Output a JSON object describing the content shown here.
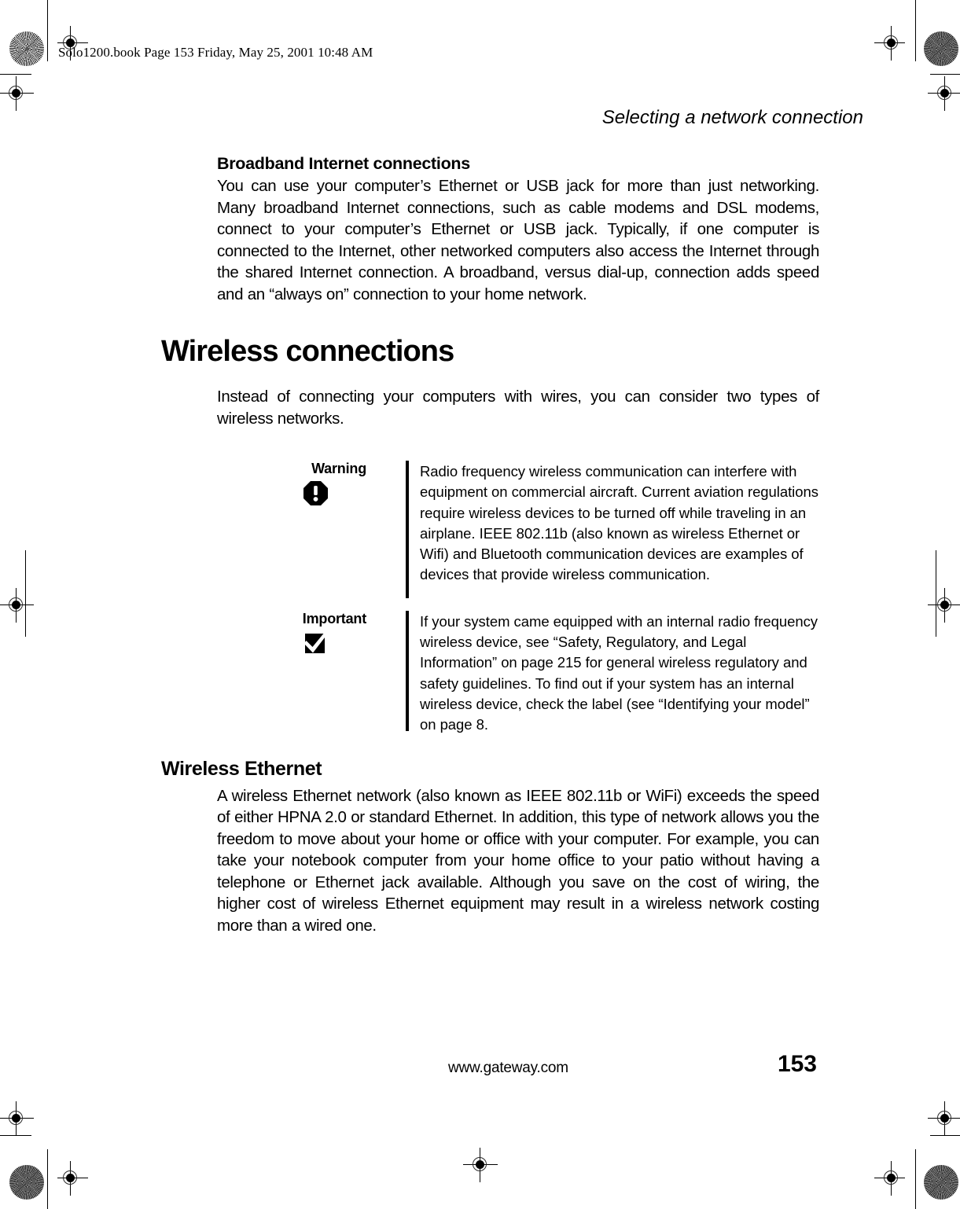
{
  "prepress": {
    "file_stamp": "Solo1200.book  Page 153  Friday, May 25, 2001  10:48 AM"
  },
  "header": {
    "running_head": "Selecting a network connection"
  },
  "sections": [
    {
      "id": "broadband",
      "heading": "Broadband Internet connections",
      "paragraph": "You can use your computer’s Ethernet or USB jack for more than just networking. Many broadband Internet connections, such as cable modems and DSL modems, connect to your computer’s Ethernet or USB jack. Typically, if one computer is connected to the Internet, other networked computers also access the Internet through the shared Internet connection. A broadband, versus dial-up, connection adds speed and an “always on” connection to your home network."
    },
    {
      "id": "wireless-connections",
      "heading": "Wireless connections",
      "paragraph": "Instead of connecting your computers with wires, you can consider two types of wireless networks."
    },
    {
      "id": "wireless-ethernet",
      "heading": "Wireless Ethernet",
      "paragraph": "A wireless Ethernet network (also known as IEEE 802.11b or WiFi) exceeds the speed of either HPNA 2.0 or standard Ethernet. In addition, this type of network allows you the freedom to move about your home or office with your computer. For example, you can take your notebook computer from your home office to your patio without having a telephone or Ethernet jack available. Although you save on the cost of wiring, the higher cost of wireless Ethernet equipment may result in a wireless network costing more than a wired one."
    }
  ],
  "callouts": [
    {
      "id": "warning",
      "label": "Warning",
      "icon": "warning-octagon-icon",
      "text": "Radio frequency wireless communication can interfere with equipment on commercial aircraft. Current aviation regulations require wireless devices to be turned off while traveling in an airplane. IEEE 802.11b (also known as wireless Ethernet or Wifi) and Bluetooth communication devices are examples of devices that provide wireless communication."
    },
    {
      "id": "important",
      "label": "Important",
      "icon": "important-checkmark-icon",
      "text": "If your system came equipped with an internal radio frequency wireless device, see “Safety, Regulatory, and Legal Information” on page 215 for general wireless regulatory and safety guidelines. To find out if your system has an internal wireless device, check the label (see “Identifying your model” on page 8."
    }
  ],
  "footer": {
    "url": "www.gateway.com",
    "page_number": "153"
  },
  "colors": {
    "ink": "#000000",
    "paper": "#ffffff"
  }
}
